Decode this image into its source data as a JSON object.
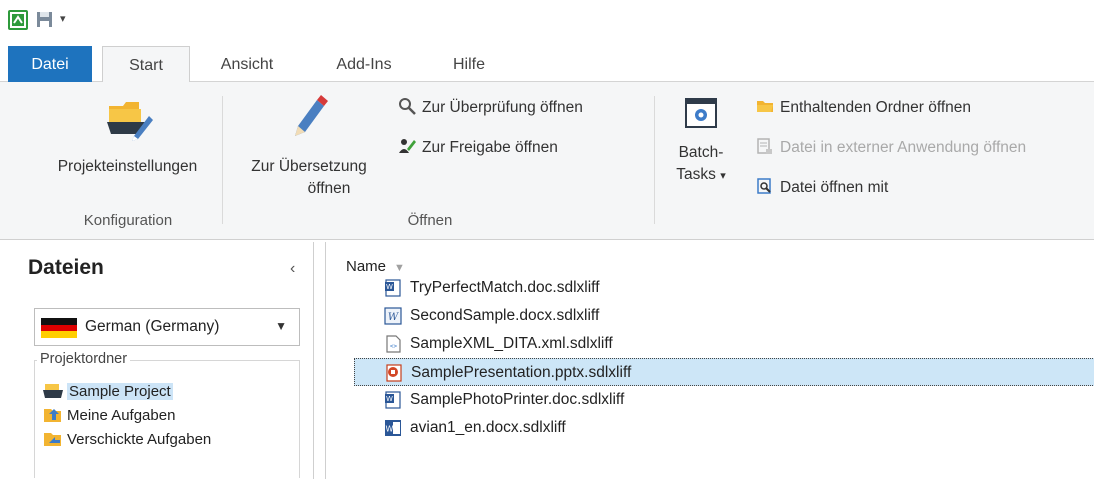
{
  "quick_access": {
    "app_icon": "studio-app-icon",
    "save_icon": "save-icon",
    "more_icon": "customize-toolbar-icon"
  },
  "tabs": [
    {
      "label": "Datei"
    },
    {
      "label": "Start"
    },
    {
      "label": "Ansicht"
    },
    {
      "label": "Add-Ins"
    },
    {
      "label": "Hilfe"
    }
  ],
  "ribbon": {
    "konfiguration": {
      "group_label": "Konfiguration",
      "project_settings_label": "Projekteinstellungen"
    },
    "oeffnen": {
      "group_label": "Öffnen",
      "translate_line1": "Zur Übersetzung",
      "translate_line2": "öffnen",
      "review_label": "Zur Überprüfung öffnen",
      "signoff_label": "Zur Freigabe öffnen"
    },
    "batch": {
      "line1": "Batch-",
      "line2": "Tasks",
      "caret": "▾"
    },
    "file_actions": {
      "open_folder_label": "Enthaltenden Ordner öffnen",
      "open_external_label": "Datei in externer Anwendung öffnen",
      "open_with_label": "Datei öffnen mit"
    }
  },
  "left_pane": {
    "title": "Dateien",
    "collapse_glyph": "‹",
    "language": "German (Germany)",
    "caret": "▼",
    "folder_legend": "Projektordner",
    "items": [
      {
        "label": "Sample Project"
      },
      {
        "label": "Meine Aufgaben"
      },
      {
        "label": "Verschickte Aufgaben"
      }
    ]
  },
  "file_list": {
    "column_name": "Name",
    "sort_glyph": "▼",
    "files": [
      {
        "name": "TryPerfectMatch.doc.sdlxliff",
        "icon": "word-doc-icon"
      },
      {
        "name": "SecondSample.docx.sdlxliff",
        "icon": "word-docx-icon"
      },
      {
        "name": "SampleXML_DITA.xml.sdlxliff",
        "icon": "xml-file-icon"
      },
      {
        "name": "SamplePresentation.pptx.sdlxliff",
        "icon": "powerpoint-icon"
      },
      {
        "name": "SamplePhotoPrinter.doc.sdlxliff",
        "icon": "word-doc-icon"
      },
      {
        "name": "avian1_en.docx.sdlxliff",
        "icon": "word-docx-icon"
      }
    ]
  },
  "colors": {
    "accent": "#1e73be",
    "selection": "#cde6f7",
    "ribbon_bg": "#f5f6f7"
  }
}
